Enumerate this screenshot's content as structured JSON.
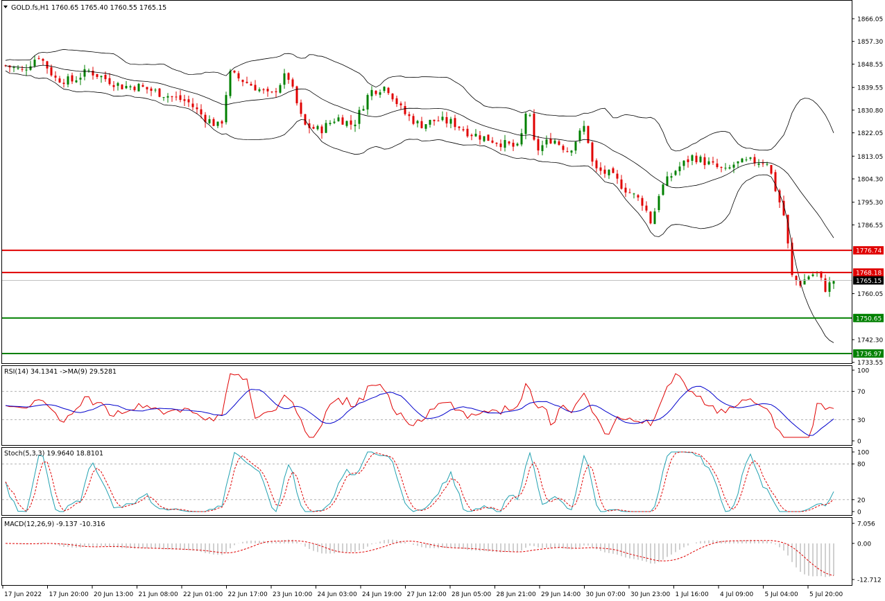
{
  "header": {
    "symbol_line": "GOLD.fs,H1  1760.65 1765.40 1760.55 1765.15"
  },
  "price_axis_labels": [
    "1866.05",
    "1857.30",
    "1848.55",
    "1839.55",
    "1830.80",
    "1822.05",
    "1813.05",
    "1804.30",
    "1795.30",
    "1786.55",
    "1760.05",
    "1742.30",
    "1733.55"
  ],
  "levels": [
    {
      "label": "1776.74",
      "value": 1776.74,
      "color": "#e00000"
    },
    {
      "label": "1768.18",
      "value": 1768.18,
      "color": "#e00000"
    },
    {
      "label": "1750.65",
      "value": 1750.65,
      "color": "#008000"
    },
    {
      "label": "1736.97",
      "value": 1736.97,
      "color": "#008000"
    }
  ],
  "current_price": {
    "label": "1765.15",
    "value": 1765.15
  },
  "rsi": {
    "header": "RSI(14) 34.1341   ->MA(9) 29.5281",
    "axis_labels": [
      "100",
      "70",
      "30",
      "0"
    ]
  },
  "stoch": {
    "header": "Stoch(5,3,3) 19.9640 18.8101",
    "axis_labels": [
      "100",
      "80",
      "20",
      "0"
    ]
  },
  "macd": {
    "header": "MACD(12,26,9) -9.137 -10.316",
    "axis_labels": [
      "7.056",
      "0.00",
      "-12.712"
    ]
  },
  "time_labels": [
    "17 Jun 2022",
    "17 Jun 20:00",
    "20 Jun 13:00",
    "21 Jun 08:00",
    "22 Jun 01:00",
    "22 Jun 17:00",
    "23 Jun 10:00",
    "24 Jun 03:00",
    "24 Jun 19:00",
    "27 Jun 12:00",
    "28 Jun 05:00",
    "28 Jun 21:00",
    "29 Jun 14:00",
    "30 Jun 07:00",
    "30 Jun 23:00",
    "1 Jul 16:00",
    "4 Jul 09:00",
    "5 Jul 04:00",
    "5 Jul 20:00"
  ],
  "colors": {
    "bull": "#008000",
    "bear": "#e00000",
    "rsi_line": "#e00000",
    "rsi_ma": "#0000cc",
    "stoch_main": "#20a0b0",
    "stoch_signal": "#e00000",
    "macd_signal": "#e00000",
    "macd_hist": "#b0b0b0",
    "current_price_bg": "#000000"
  },
  "chart_data": {
    "type": "candlestick",
    "symbol": "GOLD.fs",
    "timeframe": "H1",
    "close_path": [
      [
        0,
        1848
      ],
      [
        0.02,
        1846
      ],
      [
        0.04,
        1852
      ],
      [
        0.06,
        1843
      ],
      [
        0.08,
        1842
      ],
      [
        0.1,
        1846
      ],
      [
        0.12,
        1843
      ],
      [
        0.14,
        1840
      ],
      [
        0.16,
        1840
      ],
      [
        0.18,
        1838
      ],
      [
        0.2,
        1836
      ],
      [
        0.22,
        1834
      ],
      [
        0.24,
        1828
      ],
      [
        0.26,
        1824
      ],
      [
        0.27,
        1845
      ],
      [
        0.3,
        1840
      ],
      [
        0.32,
        1836
      ],
      [
        0.34,
        1845
      ],
      [
        0.36,
        1825
      ],
      [
        0.38,
        1823
      ],
      [
        0.4,
        1828
      ],
      [
        0.42,
        1825
      ],
      [
        0.44,
        1838
      ],
      [
        0.46,
        1840
      ],
      [
        0.48,
        1830
      ],
      [
        0.5,
        1825
      ],
      [
        0.52,
        1827
      ],
      [
        0.54,
        1826
      ],
      [
        0.56,
        1822
      ],
      [
        0.58,
        1820
      ],
      [
        0.6,
        1818
      ],
      [
        0.62,
        1816
      ],
      [
        0.63,
        1833
      ],
      [
        0.64,
        1815
      ],
      [
        0.66,
        1820
      ],
      [
        0.68,
        1815
      ],
      [
        0.7,
        1825
      ],
      [
        0.71,
        1808
      ],
      [
        0.73,
        1806
      ],
      [
        0.75,
        1800
      ],
      [
        0.77,
        1795
      ],
      [
        0.78,
        1787
      ],
      [
        0.79,
        1800
      ],
      [
        0.81,
        1808
      ],
      [
        0.83,
        1813
      ],
      [
        0.85,
        1810
      ],
      [
        0.87,
        1807
      ],
      [
        0.88,
        1810
      ],
      [
        0.9,
        1811
      ],
      [
        0.92,
        1811
      ],
      [
        0.93,
        1800
      ],
      [
        0.94,
        1790
      ],
      [
        0.95,
        1766
      ],
      [
        0.96,
        1764
      ],
      [
        0.97,
        1767
      ],
      [
        0.98,
        1768
      ],
      [
        0.99,
        1762
      ],
      [
        1,
        1765.15
      ]
    ],
    "y_axis_labels": [
      "1866.05",
      "1857.30",
      "1848.55",
      "1839.55",
      "1830.80",
      "1822.05",
      "1813.05",
      "1804.30",
      "1795.30",
      "1786.55",
      "1760.05",
      "1742.30",
      "1733.55"
    ],
    "indicators": [
      "Bollinger Bands",
      "RSI(14)",
      "Stoch(5,3,3)",
      "MACD(12,26,9)"
    ]
  }
}
